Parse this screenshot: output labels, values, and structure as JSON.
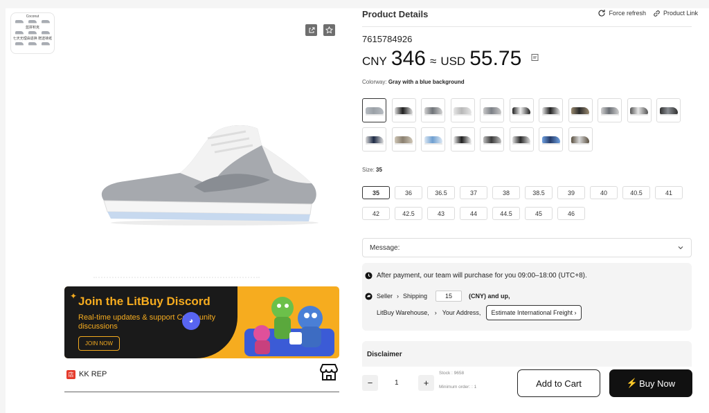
{
  "gallery": {
    "thumb_caption": "Coconut",
    "thumb_line1": "蓝拼积克",
    "thumb_line2": "七天无理由退换   赠送袜纸"
  },
  "promo": {
    "title": "Join the LitBuy Discord",
    "subtitle": "Real-time updates & support Community discussions",
    "button": "JOIN NOW"
  },
  "shop": {
    "badge": "店",
    "name": "KK REP"
  },
  "product": {
    "section_title": "Product Details",
    "force_refresh": "Force refresh",
    "product_link": "Product Link",
    "id": "7615784926",
    "price_cny_label": "CNY",
    "price_cny": "346",
    "approx": "≈",
    "price_usd_label": "USD",
    "price_usd": "55.75",
    "colorway_label": "Colorway:",
    "colorway_value": "Gray with a blue background",
    "size_label": "Size:",
    "size_value": "35"
  },
  "colorways": [
    {
      "top": "#9aa0a6",
      "accent": "#b7bcc2",
      "selected": true
    },
    {
      "top": "#1f1f1f",
      "accent": "#dcdcdc",
      "selected": false
    },
    {
      "top": "#6f7378",
      "accent": "#d0d0d0",
      "selected": false
    },
    {
      "top": "#b8b8b8",
      "accent": "#e6e6e6",
      "selected": false
    },
    {
      "top": "#7c8086",
      "accent": "#c8c8c8",
      "selected": false
    },
    {
      "top": "#f0f0f0",
      "accent": "#222222",
      "selected": false
    },
    {
      "top": "#222222",
      "accent": "#e8e8e8",
      "selected": false
    },
    {
      "top": "#2b2b2b",
      "accent": "#9a8a70",
      "selected": false
    },
    {
      "top": "#6a6e74",
      "accent": "#cfcfcf",
      "selected": false
    },
    {
      "top": "#e6e6e6",
      "accent": "#555555",
      "selected": false
    },
    {
      "top": "#8a8e93",
      "accent": "#303030",
      "selected": false
    },
    {
      "top": "#1d2a44",
      "accent": "#dcdcdc",
      "selected": false
    },
    {
      "top": "#8a8070",
      "accent": "#cfc6b6",
      "selected": false
    },
    {
      "top": "#6f9fd0",
      "accent": "#dce8f4",
      "selected": false
    },
    {
      "top": "#1e1e1e",
      "accent": "#f0f0f0",
      "selected": false
    },
    {
      "top": "#3a3a3a",
      "accent": "#bdbdbd",
      "selected": false
    },
    {
      "top": "#2a2a2a",
      "accent": "#e0e0e0",
      "selected": false
    },
    {
      "top": "#243b6a",
      "accent": "#6fa0e0",
      "selected": false
    },
    {
      "top": "#d8d8d8",
      "accent": "#5a5040",
      "selected": false
    }
  ],
  "sizes": [
    "35",
    "36",
    "36.5",
    "37",
    "38",
    "38.5",
    "39",
    "40",
    "40.5",
    "41",
    "42",
    "42.5",
    "43",
    "44",
    "44.5",
    "45",
    "46"
  ],
  "selected_size": "35",
  "message": {
    "label": "Message:"
  },
  "purchase_info": {
    "notice": "After payment, our team will purchase for you 09:00–18:00 (UTC+8).",
    "seller": "Seller",
    "shipping": "Shipping",
    "shipping_value": "15",
    "shipping_suffix": "(CNY) and up,",
    "warehouse": "LitBuy Warehouse,",
    "your_address": "Your Address,",
    "estimate_button": "Estimate International Freight"
  },
  "disclaimer": {
    "title": "Disclaimer"
  },
  "order": {
    "quantity": "1",
    "minus": "−",
    "plus": "+",
    "stock": "Stock : 9658",
    "min_order": "Minimum order: :   1",
    "add_to_cart": "Add to Cart",
    "buy_now": "Buy Now"
  },
  "icons": {
    "share": "share-icon",
    "favorite": "star-icon",
    "refresh": "refresh-icon",
    "link": "link-icon",
    "chevron": "chevron-down-icon",
    "clock": "clock-icon",
    "truck": "delivery-icon",
    "store": "store-icon",
    "bolt": "lightning-icon"
  },
  "colors": {
    "accent_orange": "#f6ac1f",
    "dark": "#111111",
    "discord_blue": "#5865f2",
    "shop_red": "#e53b2c"
  }
}
